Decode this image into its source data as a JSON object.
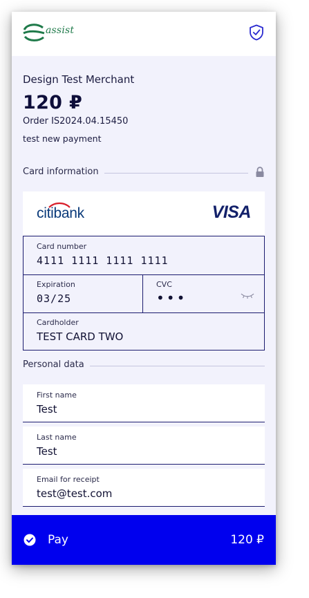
{
  "header": {
    "logo_text": "assist",
    "logo_icon": "assist-logo-icon",
    "shield_icon": "shield-check-icon"
  },
  "payment": {
    "merchant": "Design Test Merchant",
    "amount": "120 ₽",
    "order": "Order IS2024.04.15450",
    "description": "test new payment"
  },
  "card_section": {
    "title": "Card information",
    "lock_icon": "lock-icon",
    "bank_logo_text_a": "citi",
    "bank_logo_text_b": "bank",
    "network": "VISA",
    "card_number_label": "Card number",
    "card_number_value": "4111 1111 1111 1111",
    "expiration_label": "Expiration",
    "expiration_value": "03/25",
    "cvc_label": "CVC",
    "cvc_value": "•••",
    "cvc_toggle_icon": "eye-closed-icon",
    "cardholder_label": "Cardholder",
    "cardholder_value": "TEST CARD TWO"
  },
  "personal_section": {
    "title": "Personal data",
    "fields": [
      {
        "label": "First name",
        "value": "Test"
      },
      {
        "label": "Last name",
        "value": "Test"
      },
      {
        "label": "Email for receipt",
        "value": "test@test.com"
      }
    ]
  },
  "pay_button": {
    "label": "Pay",
    "amount": "120 ₽",
    "icon": "check-circle-icon",
    "color": "#0000ee"
  }
}
